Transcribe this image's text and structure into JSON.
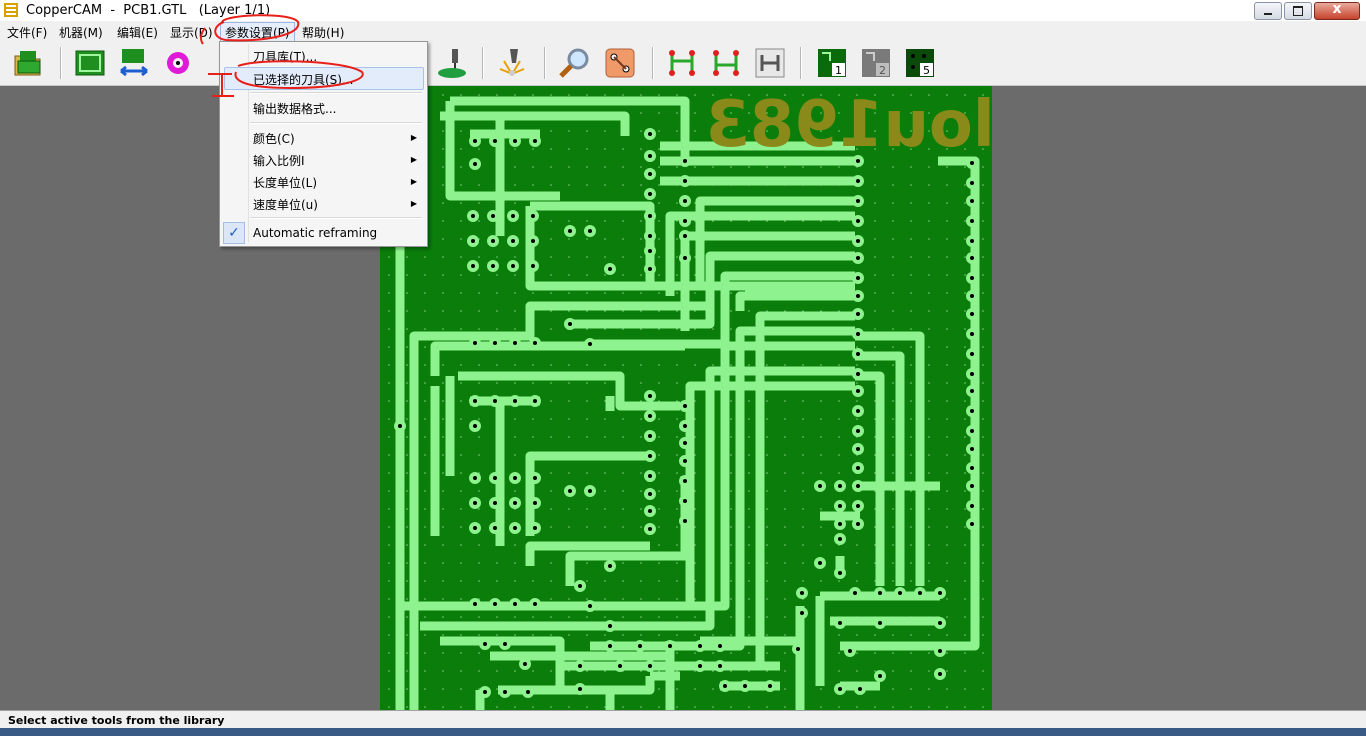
{
  "window": {
    "title": "CopperCAM  -  PCB1.GTL   (Layer 1/1)"
  },
  "menubar": {
    "items": [
      "文件(F)",
      "机器(M)",
      "编辑(E)",
      "显示(D)",
      "参数设置(P)",
      "帮助(H)"
    ]
  },
  "toolbar": {
    "tools": [
      "open-folder-icon",
      "board-icon",
      "swap-arrows-icon",
      "target-icon",
      "milling-icon",
      "drill-icon",
      "zoom-icon",
      "pads-icon",
      "tracks-icon",
      "tracks-alt-icon",
      "tracks-grey-icon",
      "layer-1-icon",
      "layer-2-icon",
      "layer-5-icon"
    ],
    "layer_numbers": [
      "1",
      "2",
      "5"
    ]
  },
  "dropdown": {
    "items": [
      {
        "label": "刀具库(T)...",
        "submenu": false
      },
      {
        "label": "已选择的刀具(S)...",
        "submenu": false,
        "highlighted": true
      },
      {
        "label": "输出数据格式...",
        "submenu": false
      },
      {
        "label": "颜色(C)",
        "submenu": true
      },
      {
        "label": "输入比例I",
        "submenu": true
      },
      {
        "label": "长度单位(L)",
        "submenu": true
      },
      {
        "label": "速度单位(u)",
        "submenu": true
      },
      {
        "label": "Automatic reframing",
        "submenu": false,
        "checked": true
      }
    ]
  },
  "board": {
    "mirrored_text": "lou1983"
  },
  "annotation": {
    "handwritten_mark": "1"
  },
  "status": {
    "text": "Select active tools from the library"
  },
  "colors": {
    "board": "#0a7d0a",
    "track": "#8ef28e",
    "silk": "#8a8a1a",
    "background": "#6b6b6b",
    "ink": "#e8201a"
  }
}
